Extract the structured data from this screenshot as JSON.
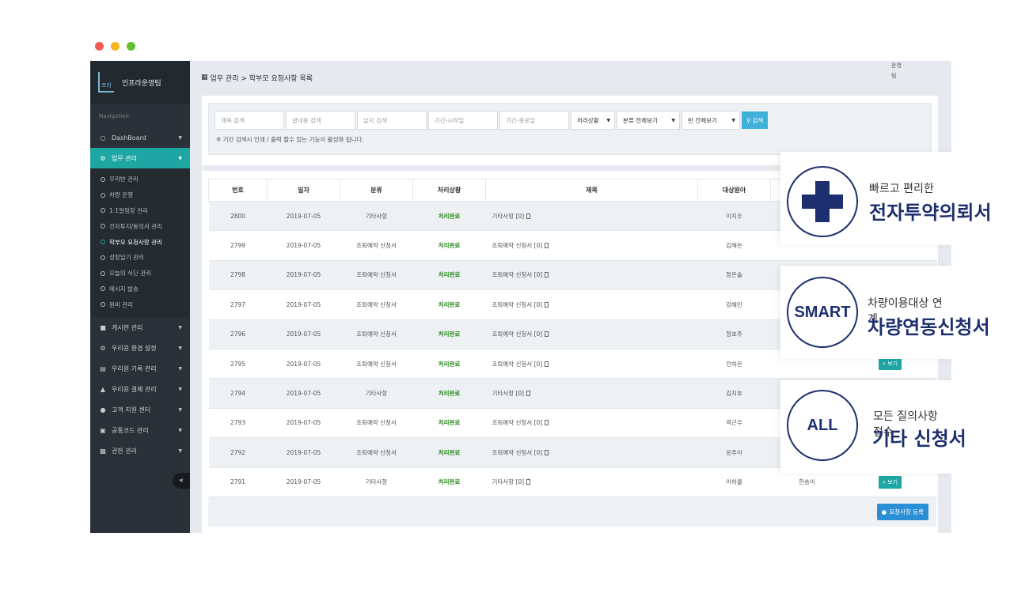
{
  "window_dots": {
    "colors": [
      "#f25b57",
      "#f6b51e",
      "#5fc132"
    ]
  },
  "sidebar": {
    "brand": "인프라운영팀",
    "brand_logo": "프라",
    "nav_caption": "Navigation",
    "items": [
      {
        "label": "DashBoard",
        "icon": "speech-bubble-icon"
      },
      {
        "label": "업무 관리",
        "icon": "gear-icon",
        "active": true
      }
    ],
    "subitems": [
      "우리반 관리",
      "차량 운행",
      "1:1알림장 관리",
      "전자투지/동의서 관리",
      "학부모 요청사항 관리",
      "성장일기 관리",
      "오늘의 식단 관리",
      "메시지 발송",
      "원비 관리"
    ],
    "current_subitem": 4,
    "more_items": [
      {
        "label": "게시판 관리",
        "icon": "book-icon"
      },
      {
        "label": "우리원 환경 설정",
        "icon": "cogs-icon"
      },
      {
        "label": "우리원 기록 관리",
        "icon": "chart-icon"
      },
      {
        "label": "우리원 결제 관리",
        "icon": "bank-icon"
      },
      {
        "label": "고객 지원 센터",
        "icon": "support-icon"
      },
      {
        "label": "공통코드 관리",
        "icon": "gift-icon"
      },
      {
        "label": "권한 관리",
        "icon": "window-icon"
      }
    ],
    "collapse": "«"
  },
  "header": {
    "breadcrumb": "업무 관리 > 학부모 요청사항 목록",
    "user_tag": "운영팀"
  },
  "search": {
    "title_placeholder": "제목 검색",
    "content_placeholder": "글내용 검색",
    "writer_placeholder": "낱자 검색",
    "start_placeholder": "기간-시작일",
    "end_placeholder": "기간-종료일",
    "status_select": "처리상황",
    "category_select": "분류 전체보기",
    "class_select": "반 전체보기",
    "search_button": "검색",
    "note": "※ 기간 검색시 인쇄 / 출력 할수 있는 기능이 활성화 됩니다."
  },
  "table": {
    "headers": [
      "번호",
      "일자",
      "분류",
      "처리상황",
      "제목",
      "대상원아",
      "",
      ""
    ],
    "rows": [
      {
        "no": "2800",
        "date": "2019-07-05",
        "category": "기타사항",
        "status": "처리완료",
        "title": "기타사항 [0]",
        "child": "이지우",
        "teacher": "",
        "action": ""
      },
      {
        "no": "2799",
        "date": "2019-07-05",
        "category": "조퇴예약 신청서",
        "status": "처리완료",
        "title": "조퇴예약 신청서 [0]",
        "child": "김해든",
        "teacher": "",
        "action": ""
      },
      {
        "no": "2798",
        "date": "2019-07-05",
        "category": "조퇴예약 신청서",
        "status": "처리완료",
        "title": "조퇴예약 신청서 [0]",
        "child": "정은솔",
        "teacher": "",
        "action": ""
      },
      {
        "no": "2797",
        "date": "2019-07-05",
        "category": "조퇴예약 신청서",
        "status": "처리완료",
        "title": "조퇴예약 신청서 [0]",
        "child": "강혜민",
        "teacher": "",
        "action": ""
      },
      {
        "no": "2796",
        "date": "2019-07-05",
        "category": "조퇴예약 신청서",
        "status": "처리완료",
        "title": "조퇴예약 신청서 [0]",
        "child": "정호주",
        "teacher": "",
        "action": ""
      },
      {
        "no": "2795",
        "date": "2019-07-05",
        "category": "조퇴예약 신청서",
        "status": "처리완료",
        "title": "조퇴예약 신청서 [0]",
        "child": "전하은",
        "teacher": "",
        "action": "보기"
      },
      {
        "no": "2794",
        "date": "2019-07-05",
        "category": "기타사항",
        "status": "처리완료",
        "title": "기타사항 [0]",
        "child": "김지호",
        "teacher": "",
        "action": ""
      },
      {
        "no": "2793",
        "date": "2019-07-05",
        "category": "조퇴예약 신청서",
        "status": "처리완료",
        "title": "조퇴예약 신청서 [0]",
        "child": "곽근우",
        "teacher": "",
        "action": ""
      },
      {
        "no": "2792",
        "date": "2019-07-05",
        "category": "조퇴예약 신청서",
        "status": "처리완료",
        "title": "조퇴예약 신청서 [0]",
        "child": "윤주아",
        "teacher": "",
        "action": ""
      },
      {
        "no": "2791",
        "date": "2019-07-05",
        "category": "기타사항",
        "status": "처리완료",
        "title": "기타사항 [0]",
        "child": "이하율",
        "teacher": "한송이",
        "action": "보기"
      }
    ],
    "register_button": "요청사항 등록"
  },
  "features": [
    {
      "badge": "",
      "subtitle": "빠르고 편리한",
      "title": "전자투약의뢰서"
    },
    {
      "badge": "SMART",
      "subtitle": "차량이용대상 연계",
      "title": "차량연동신청서"
    },
    {
      "badge": "ALL",
      "subtitle": "모든 질의사항 접수",
      "title": "기타 신청서"
    }
  ]
}
